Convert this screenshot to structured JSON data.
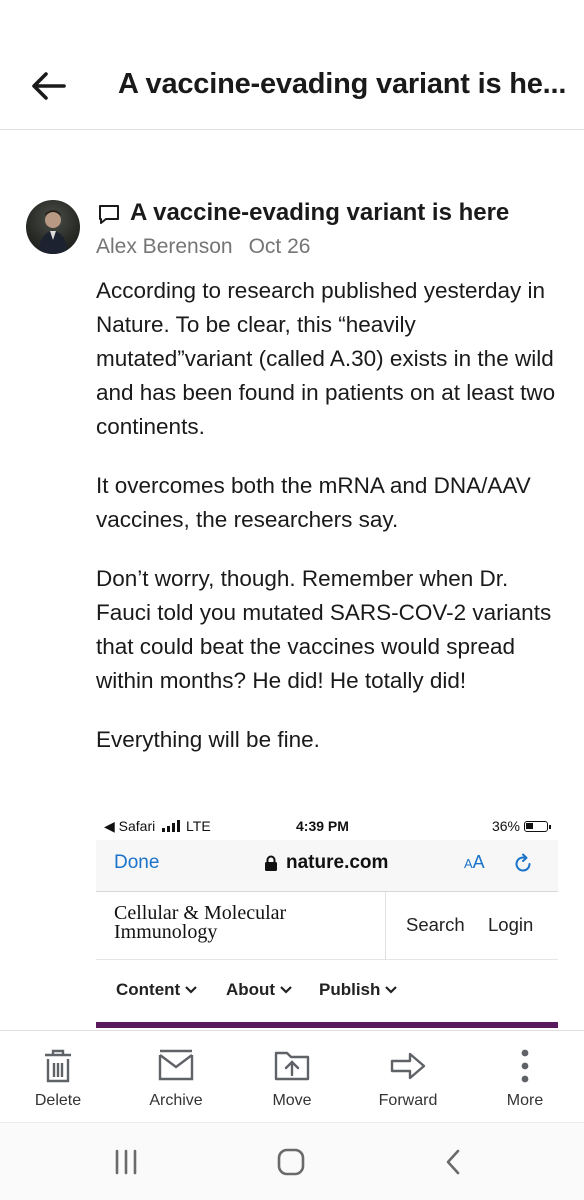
{
  "header": {
    "title": "A vaccine-evading variant is he..."
  },
  "message": {
    "subject": "A vaccine-evading variant is here",
    "author": "Alex Berenson",
    "date": "Oct 26",
    "paragraphs": [
      "According to research published yesterday in Nature. To be clear, this “heavily mutated”variant (called A.30) exists in the wild and has been found in patients on at least two continents.",
      "It overcomes both the mRNA and DNA/AAV vaccines, the researchers say.",
      "Don’t worry, though. Remember when Dr. Fauci told you mutated SARS-COV-2 variants that could beat the vaccines would spread within months? He did! He totally did!",
      "Everything will be fine."
    ]
  },
  "embed": {
    "status": {
      "carrier": "◀ Safari",
      "network": "LTE",
      "time": "4:39 PM",
      "battery": "36%"
    },
    "browser": {
      "done": "Done",
      "domain": "nature.com",
      "text_size_small": "A",
      "text_size_large": "A"
    },
    "site": {
      "journal_line1": "Cellular & Molecular",
      "journal_line2": "Immunology",
      "search": "Search",
      "login": "Login",
      "nav": [
        "Content",
        "About",
        "Publish"
      ]
    }
  },
  "toolbar": {
    "delete": "Delete",
    "archive": "Archive",
    "move": "Move",
    "forward": "Forward",
    "more": "More"
  },
  "colors": {
    "link_blue": "#1a73c9",
    "journal_purple": "#5b1a5e",
    "meta_gray": "#757575"
  }
}
